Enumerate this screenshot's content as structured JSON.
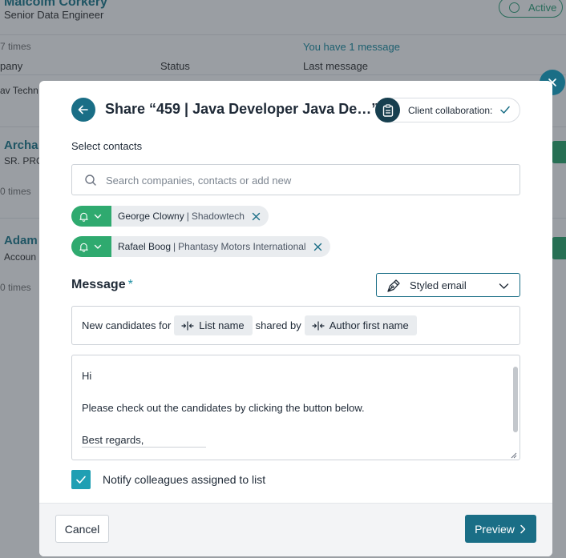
{
  "background": {
    "person_name": "Malcolm Corkery",
    "person_role": "Senior Data Engineer",
    "status_badge": "Active",
    "times_label": "7 times",
    "message_notice": "You have 1 message",
    "columns": {
      "company": "pany",
      "status": "Status",
      "last_message": "Last message"
    },
    "row1_company": "av Techn",
    "row2_name": "Archa",
    "row2_role": "SR. PRO",
    "row2_times": "0 times",
    "row3_name": "Adam",
    "row3_role": "Accoun",
    "row3_times": "0 times"
  },
  "modal": {
    "title": "Share “459 | Java Developer Java De…”",
    "client_collaboration_label": "Client collaboration:",
    "select_contacts_label": "Select contacts",
    "search_placeholder": "Search companies, contacts or add new",
    "contacts": [
      {
        "name": "George Clowny",
        "company": "Shadowtech"
      },
      {
        "name": "Rafael Boog",
        "company": "Phantasy Motors International"
      }
    ],
    "contact_separator": "|",
    "message_label": "Message",
    "required_mark": "*",
    "email_style": "Styled email",
    "subject": {
      "prefix": "New candidates for",
      "var1": "List name",
      "middle": "shared by",
      "var2": "Author first name"
    },
    "body": {
      "line1": "Hi",
      "line2": "Please check out the candidates by clicking the button below.",
      "line3": "Best regards,"
    },
    "notify_label": "Notify colleagues assigned to list",
    "notify_checked": true,
    "cancel_label": "Cancel",
    "preview_label": "Preview"
  },
  "colors": {
    "primary": "#1a6e86",
    "green": "#2faa6f",
    "checkbox": "#1f9fb3",
    "collab_icon_bg": "#173f4f"
  }
}
